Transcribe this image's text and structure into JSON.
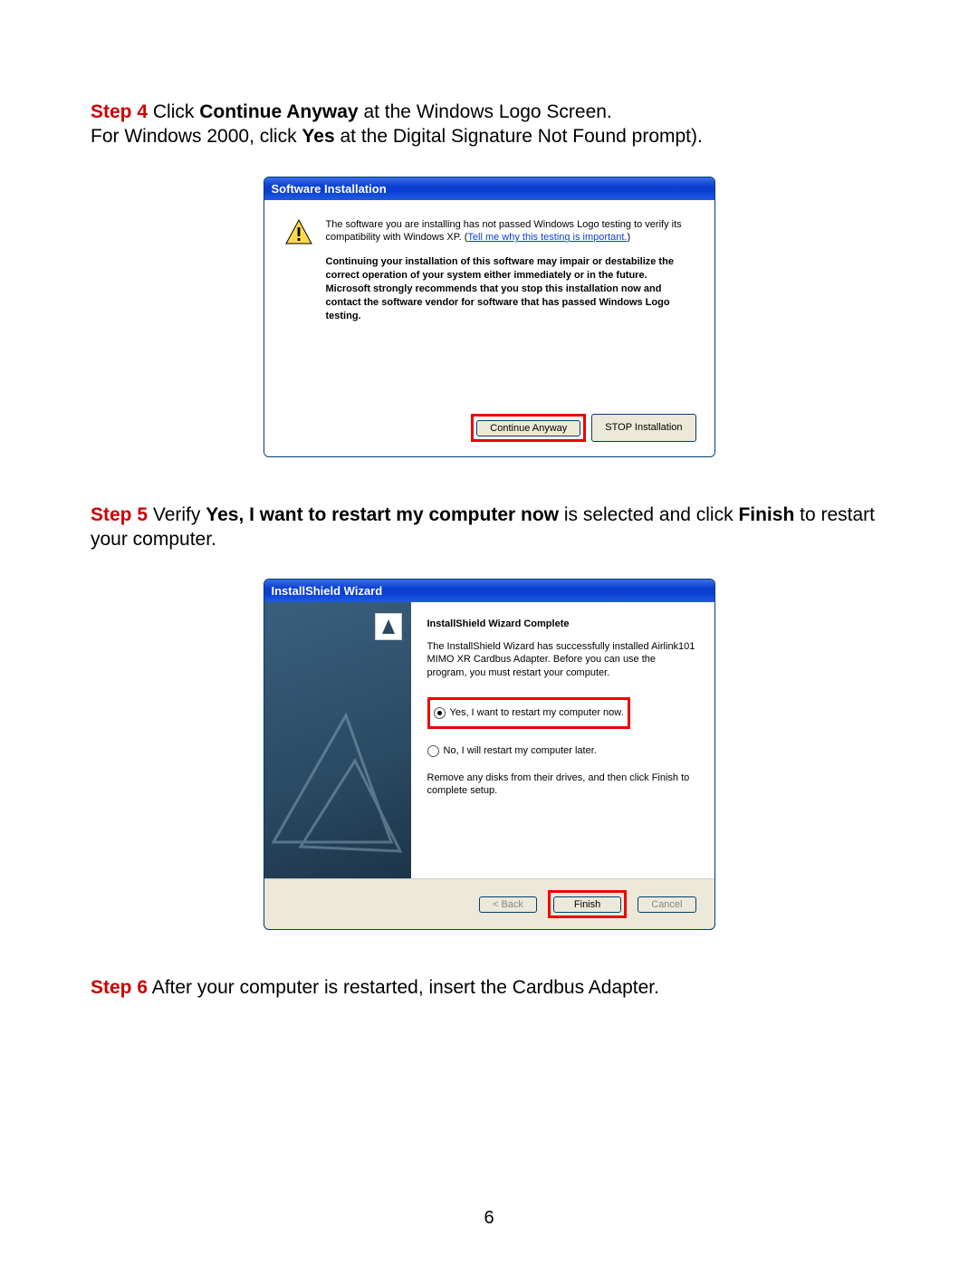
{
  "step4": {
    "label": "Step 4",
    "pre": " Click ",
    "bold1": "Continue Anyway",
    "post1": " at the Windows Logo Screen.",
    "line2_pre": "For Windows 2000, click ",
    "line2_bold": "Yes",
    "line2_post": " at the Digital Signature Not Found prompt)."
  },
  "dlg1": {
    "title": "Software Installation",
    "msg_start": "The software you are installing has not passed Windows Logo testing to verify its compatibility with Windows XP. (",
    "link": "Tell me why this testing is important.",
    "msg_end": ")",
    "bold": "Continuing your installation of this software may impair or destabilize the correct operation of your system either immediately or in the future. Microsoft strongly recommends that you stop this installation now and contact the software vendor for software that has passed Windows Logo testing.",
    "btn_continue": "Continue Anyway",
    "btn_stop": "STOP Installation"
  },
  "step5": {
    "label": "Step 5",
    "pre": " Verify ",
    "bold1": "Yes, I want to restart my computer now",
    "mid": " is selected and click ",
    "bold2": "Finish",
    "post": " to restart your computer."
  },
  "dlg2": {
    "title": "InstallShield Wizard",
    "heading": "InstallShield Wizard Complete",
    "para1": "The InstallShield Wizard has successfully installed Airlink101 MIMO XR Cardbus Adapter.  Before you can use the program, you must restart your computer.",
    "radio_yes": "Yes, I want to restart my computer now.",
    "radio_no": "No, I will restart my computer later.",
    "para2": "Remove any disks from their drives, and then click Finish to complete setup.",
    "btn_back": "< Back",
    "btn_finish": "Finish",
    "btn_cancel": "Cancel"
  },
  "step6": {
    "label": "Step 6",
    "text": " After your computer is restarted, insert the Cardbus Adapter."
  },
  "page_number": "6"
}
